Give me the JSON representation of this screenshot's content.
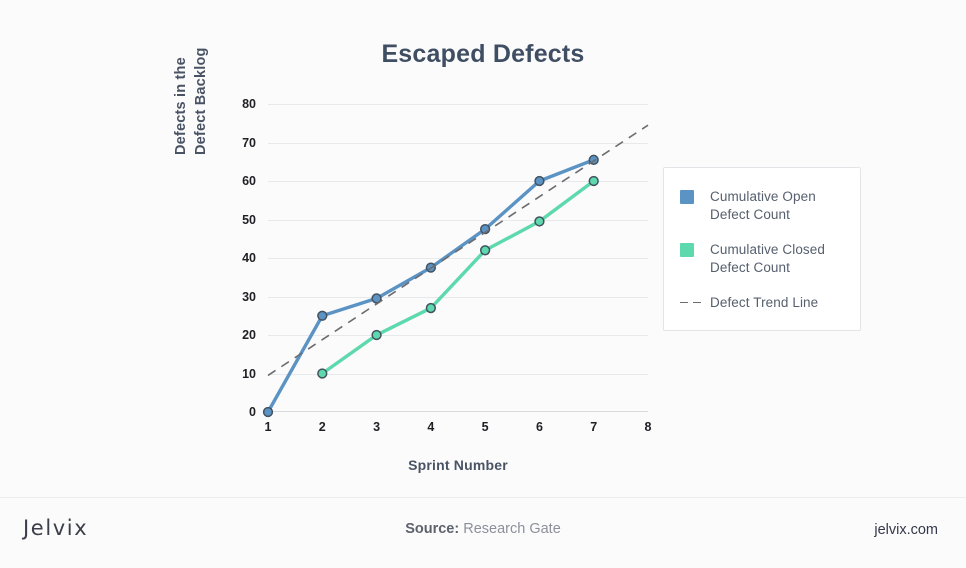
{
  "chart_data": {
    "type": "line",
    "title": "Escaped Defects",
    "xlabel": "Sprint Number",
    "ylabel": "Defects in the Defect Backlog",
    "ylabel_line1": "Defects in the",
    "ylabel_line2": "Defect Backlog",
    "x": [
      1,
      2,
      3,
      4,
      5,
      6,
      7,
      8
    ],
    "categories": [
      "1",
      "2",
      "3",
      "4",
      "5",
      "6",
      "7",
      "8"
    ],
    "yticks": [
      0,
      10,
      20,
      30,
      40,
      50,
      60,
      70,
      80
    ],
    "ytick_labels": [
      "0",
      "10",
      "20",
      "30",
      "40",
      "50",
      "60",
      "70",
      "80"
    ],
    "xlim": [
      1,
      8
    ],
    "ylim": [
      0,
      80
    ],
    "grid": true,
    "legend_position": "right",
    "series": [
      {
        "name": "Cumulative Open Defect Count",
        "legend_label_line1": "Cumulative Open",
        "legend_label_line2": "Defect Count",
        "color": "#5a93c4",
        "marker": "circle",
        "x": [
          1,
          2,
          3,
          4,
          5,
          6,
          7
        ],
        "values": [
          0,
          25,
          29.5,
          37.5,
          47.5,
          60,
          65.5
        ]
      },
      {
        "name": "Cumulative Closed Defect Count",
        "legend_label_line1": "Cumulative Closed",
        "legend_label_line2": "Defect Count",
        "color": "#5dd9ad",
        "marker": "circle",
        "x": [
          2,
          3,
          4,
          5,
          6,
          7
        ],
        "values": [
          10,
          20,
          27,
          42,
          49.5,
          60
        ]
      },
      {
        "name": "Defect Trend Line",
        "legend_label_line1": "Defect Trend Line",
        "legend_label_line2": "",
        "color": "#6c6c70",
        "style": "dashed",
        "x": [
          1,
          8
        ],
        "values": [
          9.5,
          74.5
        ]
      }
    ]
  },
  "footer": {
    "brand": "Jelvix",
    "source_prefix": "Source:",
    "source_name": "Research Gate",
    "website": "jelvix.com"
  }
}
